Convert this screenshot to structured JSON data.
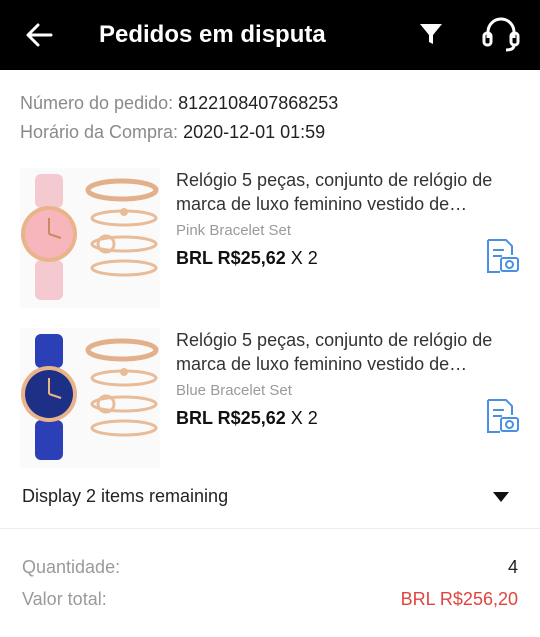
{
  "header": {
    "title": "Pedidos em disputa",
    "back_icon": "back-arrow-icon",
    "filter_icon": "filter-icon",
    "support_icon": "headset-icon"
  },
  "order": {
    "number_label": "Número do pedido:",
    "number_value": "8122108407868253",
    "purchase_time_label": "Horário da Compra:",
    "purchase_time_value": "2020-12-01 01:59"
  },
  "products": [
    {
      "name": "Relógio 5 peças, conjunto de relógio de marca de luxo feminino vestido de…",
      "variant": "Pink Bracelet Set",
      "price": "BRL R$25,62",
      "quantity": "X 2",
      "strap_color": "#f4c9cf",
      "dial_color": "#f7b6bb"
    },
    {
      "name": "Relógio 5 peças, conjunto de relógio de marca de luxo feminino vestido de…",
      "variant": "Blue Bracelet Set",
      "price": "BRL R$25,62",
      "quantity": "X 2",
      "strap_color": "#2b3fb6",
      "dial_color": "#1e2f86"
    }
  ],
  "remaining": {
    "label": "Display 2 items remaining"
  },
  "summary": {
    "quantity_label": "Quantidade:",
    "quantity_value": "4",
    "total_label": "Valor total:",
    "total_value": "BRL R$256,20"
  },
  "colors": {
    "header_bg": "#000000",
    "total_price": "#e0443f",
    "doc_icon": "#4a90e2"
  }
}
